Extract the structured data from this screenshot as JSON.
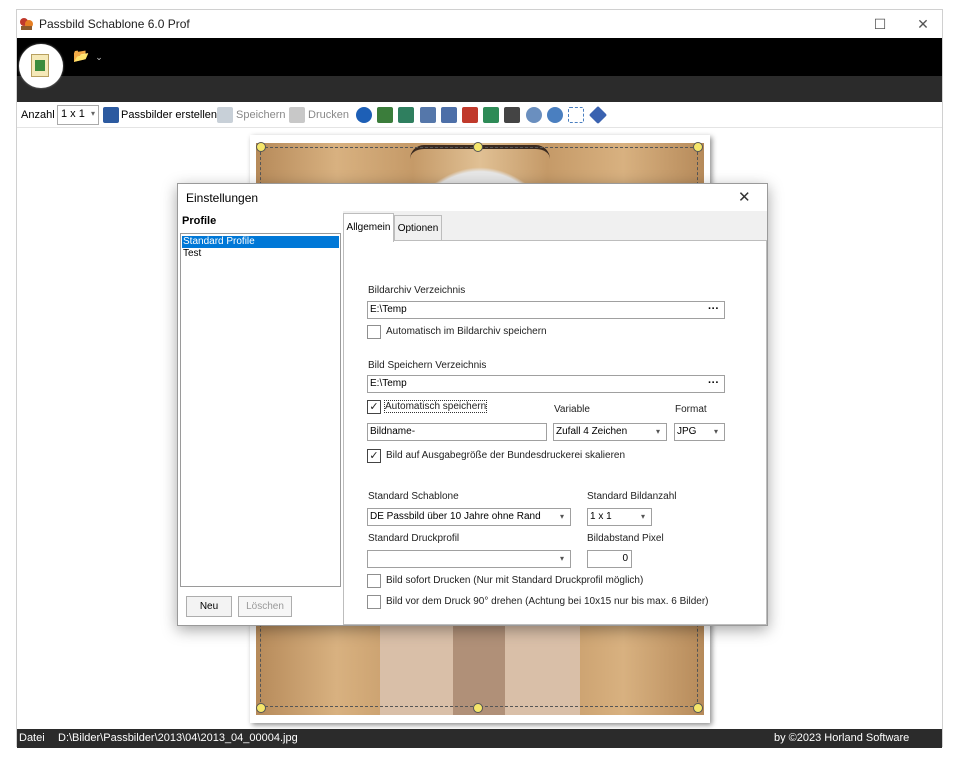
{
  "window": {
    "title": "Passbild Schablone 6.0 Prof",
    "maximize_glyph": "☐",
    "close_glyph": "✕"
  },
  "ribbon": {
    "folder_icon": "folder-icon",
    "folder_glyph": "📂",
    "chevron_glyph": "⌄"
  },
  "toolbar": {
    "anzahl_label": "Anzahl",
    "anzahl_value": "1 x 1",
    "create_label": "Passbilder erstellen",
    "save_label": "Speichern",
    "print_label": "Drucken",
    "tool_icons": [
      "undo-icon",
      "image-green-icon",
      "image-landscape-icon",
      "flip-horizontal-icon",
      "flip-vertical-icon",
      "color-icon",
      "pipette-icon",
      "picture-icon",
      "zoom-out-icon",
      "zoom-in-icon",
      "grid-icon",
      "diamond-icon"
    ]
  },
  "status": {
    "label": "Datei",
    "path": "D:\\Bilder\\Passbilder\\2013\\04\\2013_04_00004.jpg",
    "copyright": "by ©2023 Horland Software"
  },
  "dialog": {
    "title": "Einstellungen",
    "close_glyph": "✕",
    "profiles_heading": "Profile",
    "profiles": [
      "Standard Profile",
      "Test"
    ],
    "selected_profile_index": 0,
    "new_button": "Neu",
    "delete_button": "Löschen",
    "tabs": [
      "Allgemein",
      "Optionen"
    ],
    "active_tab": "Allgemein",
    "general": {
      "archive_dir_label": "Bildarchiv Verzeichnis",
      "archive_dir_value": "E:\\Temp",
      "browse_glyph": "···",
      "auto_archive_label": "Automatisch im Bildarchiv speichern",
      "auto_archive_checked": false,
      "save_dir_label": "Bild Speichern Verzeichnis",
      "save_dir_value": "E:\\Temp",
      "auto_save_label": "Automatisch speichern",
      "auto_save_checked": true,
      "variable_label": "Variable",
      "format_label": "Format",
      "filename_value": "Bildname-",
      "variable_value": "Zufall 4 Zeichen",
      "format_value": "JPG",
      "scale_label": "Bild auf Ausgabegröße der Bundesdruckerei skalieren",
      "scale_checked": true,
      "template_label": "Standard Schablone",
      "template_value": "DE Passbild über 10 Jahre ohne Rand",
      "count_label": "Standard Bildanzahl",
      "count_value": "1 x 1",
      "print_profile_label": "Standard Druckprofil",
      "print_profile_value": "",
      "spacing_label": "Bildabstand Pixel",
      "spacing_value": "0",
      "print_now_label": "Bild sofort Drucken (Nur mit Standard Druckprofil möglich)",
      "print_now_checked": false,
      "rotate_label": "Bild vor dem Druck 90° drehen (Achtung bei 10x15 nur bis max. 6 Bilder)",
      "rotate_checked": false,
      "check_glyph": "✓",
      "dropdown_glyph": "▾"
    }
  }
}
